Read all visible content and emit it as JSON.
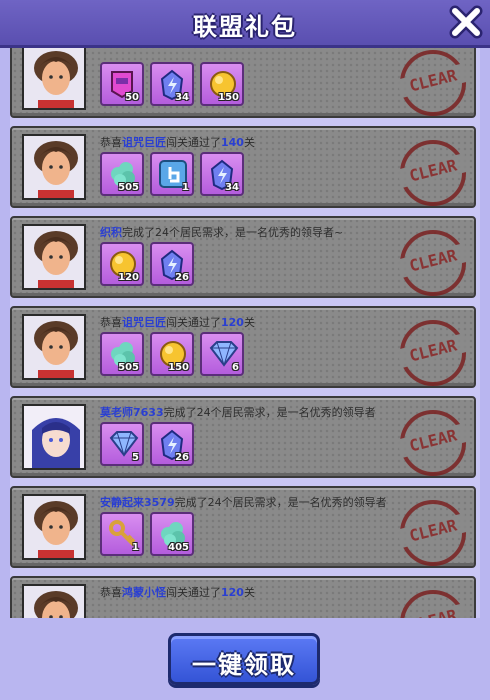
{
  "header": {
    "title": "联盟礼包"
  },
  "rows": [
    {
      "avatar": "avatar-curly-hair",
      "prefix": "",
      "name": "",
      "suffix": "",
      "items": [
        {
          "icon": "card-icon",
          "count": "50"
        },
        {
          "icon": "energy-gem-icon",
          "count": "34"
        },
        {
          "icon": "gold-coin-icon",
          "count": "150"
        }
      ],
      "stamp": "CLEAR"
    },
    {
      "avatar": "avatar-curly-hair",
      "prefix": "恭喜",
      "name": "诅咒巨匠",
      "suffix": "闯关通过了",
      "level": "140",
      "level_suffix": "关",
      "items": [
        {
          "icon": "cloud-icon",
          "count": "505"
        },
        {
          "icon": "tap-hand-icon",
          "count": "1"
        },
        {
          "icon": "energy-gem-icon",
          "count": "34"
        }
      ],
      "stamp": "CLEAR"
    },
    {
      "avatar": "avatar-curly-hair",
      "prefix": "",
      "name": "织积",
      "suffix": "完成了24个居民需求，是一名优秀的领导者~",
      "items": [
        {
          "icon": "gold-coin-icon",
          "count": "120"
        },
        {
          "icon": "energy-gem-icon",
          "count": "26"
        }
      ],
      "stamp": "CLEAR"
    },
    {
      "avatar": "avatar-curly-hair",
      "prefix": "恭喜",
      "name": "诅咒巨匠",
      "suffix": "闯关通过了",
      "level": "120",
      "level_suffix": "关",
      "items": [
        {
          "icon": "cloud-icon",
          "count": "505"
        },
        {
          "icon": "gold-coin-icon",
          "count": "150"
        },
        {
          "icon": "diamond-icon",
          "count": "6"
        }
      ],
      "stamp": "CLEAR"
    },
    {
      "avatar": "avatar-blue-hair",
      "prefix": "",
      "name": "莫老师7633",
      "suffix": "完成了24个居民需求，是一名优秀的领导者",
      "items": [
        {
          "icon": "diamond-icon",
          "count": "5"
        },
        {
          "icon": "energy-gem-icon",
          "count": "26"
        }
      ],
      "stamp": "CLEAR"
    },
    {
      "avatar": "avatar-curly-hair",
      "prefix": "",
      "name": "安静起来3579",
      "suffix": "完成了24个居民需求，是一名优秀的领导者",
      "items": [
        {
          "icon": "key-icon",
          "count": "1"
        },
        {
          "icon": "cloud-icon",
          "count": "405"
        }
      ],
      "stamp": "CLEAR"
    },
    {
      "avatar": "avatar-curly-hair",
      "prefix": "恭喜",
      "name": "鸿蒙小怪",
      "suffix": "闯关通过了",
      "level": "120",
      "level_suffix": "关",
      "items": [],
      "stamp": "CLEAR"
    }
  ],
  "claim_button": {
    "label": "一键领取"
  },
  "colors": {
    "header": "#5a4fb0",
    "highlight": "#2a3fd2",
    "item_bg": "#c46fe6",
    "stamp": "#8a1f1f",
    "button": "#3454d6"
  }
}
